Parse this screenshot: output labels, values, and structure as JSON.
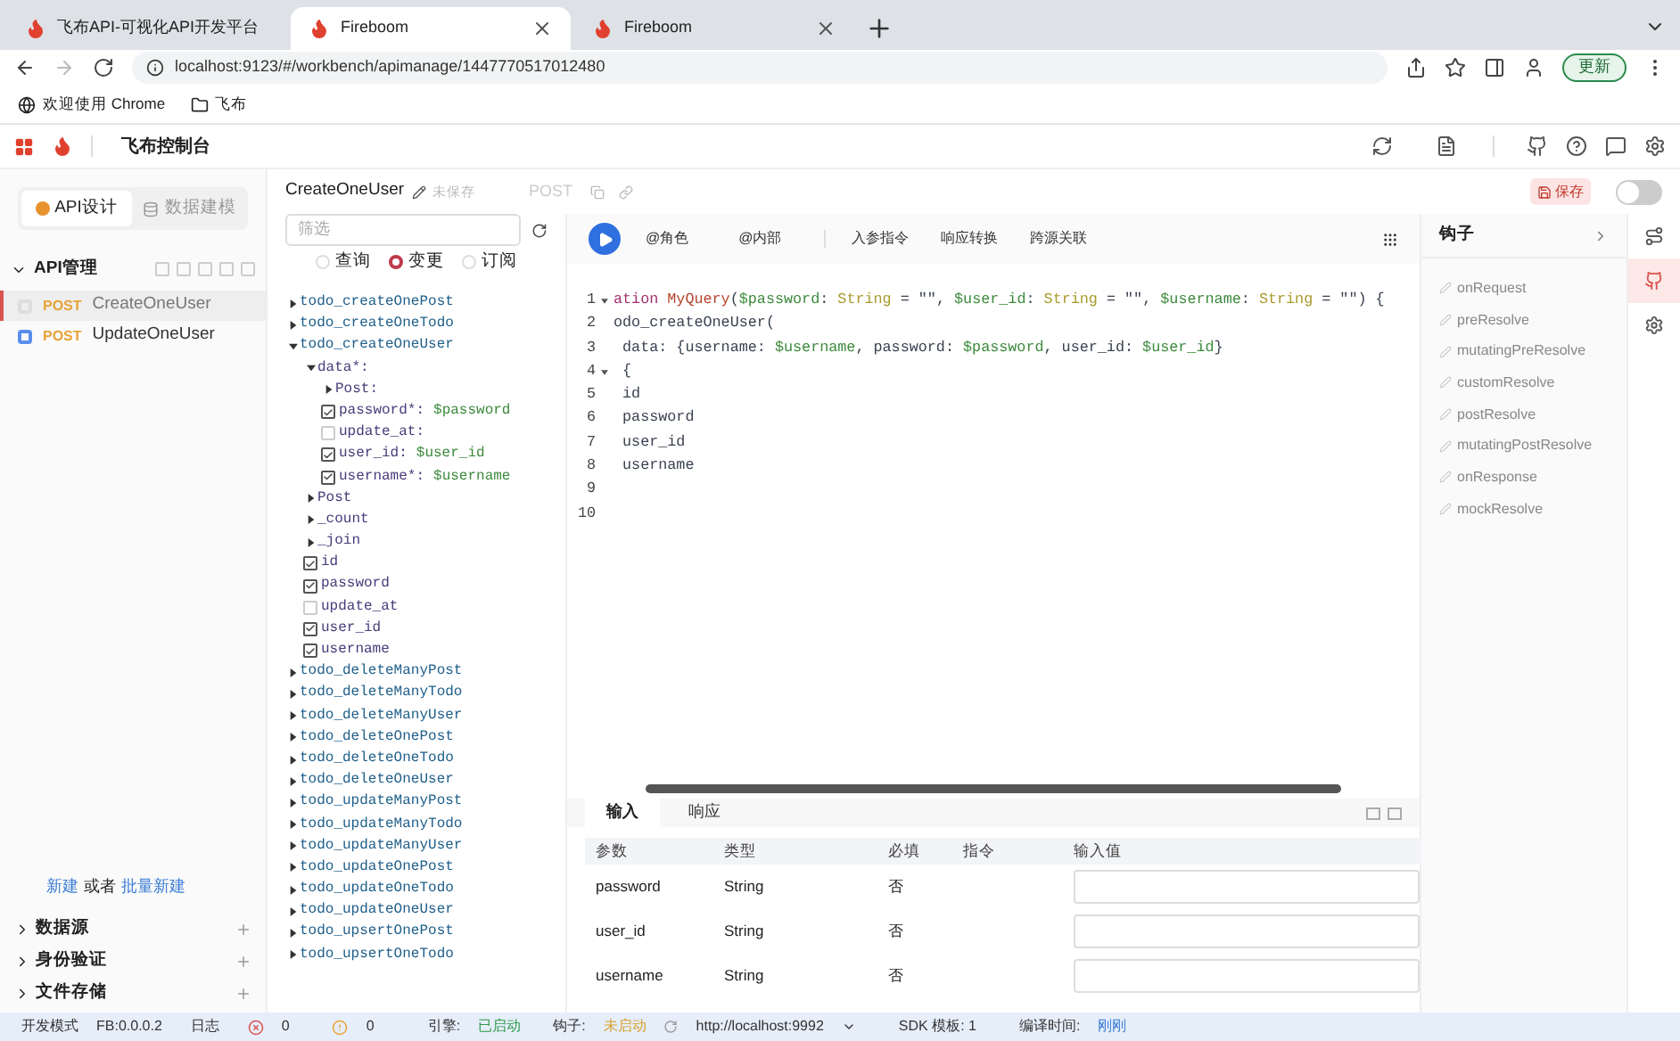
{
  "browser": {
    "tabs": [
      {
        "title": "飞布API-可视化API开发平台",
        "selected": false
      },
      {
        "title": "Fireboom",
        "selected": true
      },
      {
        "title": "Fireboom",
        "selected": false
      }
    ],
    "address": "localhost:9123/#/workbench/apimanage/1447770517012480",
    "update_button": "更新",
    "bookmarks": [
      "欢迎使用 Chrome",
      "飞布"
    ]
  },
  "app_header": {
    "title": "飞布控制台"
  },
  "sidebar": {
    "tabs": [
      {
        "label": "API设计",
        "selected": true
      },
      {
        "label": "数据建模",
        "selected": false
      }
    ],
    "section": "API管理",
    "apis": [
      {
        "method": "POST",
        "name": "CreateOneUser",
        "selected": true
      },
      {
        "method": "POST",
        "name": "UpdateOneUser",
        "selected": false
      }
    ],
    "create_link": "新建",
    "or_text": "或者",
    "batch_link": "批量新建",
    "groups": [
      "数据源",
      "身份验证",
      "文件存储"
    ]
  },
  "editor_header": {
    "name": "CreateOneUser",
    "status": "未保存",
    "method": "POST",
    "save_button": "保存",
    "toggle_on": false
  },
  "schema": {
    "filter_placeholder": "筛选",
    "radios": [
      {
        "label": "查询",
        "selected": false
      },
      {
        "label": "变更",
        "selected": true
      },
      {
        "label": "订阅",
        "selected": false
      }
    ],
    "tree": [
      {
        "kind": "branch",
        "label": "todo_createOnePost",
        "expanded": false
      },
      {
        "kind": "branch",
        "label": "todo_createOneTodo",
        "expanded": false
      },
      {
        "kind": "branch",
        "label": "todo_createOneUser",
        "expanded": true,
        "children": [
          {
            "kind": "branch",
            "label": "data*:",
            "expanded": true,
            "children": [
              {
                "kind": "branch",
                "label": "Post:",
                "expanded": false
              },
              {
                "kind": "field",
                "label": "password*:",
                "value": "$password",
                "checked": true
              },
              {
                "kind": "field",
                "label": "update_at:",
                "checked": false
              },
              {
                "kind": "field",
                "label": "user_id:",
                "value": "$user_id",
                "checked": true
              },
              {
                "kind": "field",
                "label": "username*:",
                "value": "$username",
                "checked": true
              }
            ]
          },
          {
            "kind": "branch",
            "label": "Post",
            "expanded": false
          },
          {
            "kind": "branch",
            "label": "_count",
            "expanded": false
          },
          {
            "kind": "branch",
            "label": "_join",
            "expanded": false
          },
          {
            "kind": "field",
            "label": "id",
            "checked": true
          },
          {
            "kind": "field",
            "label": "password",
            "checked": true
          },
          {
            "kind": "field",
            "label": "update_at",
            "checked": false
          },
          {
            "kind": "field",
            "label": "user_id",
            "checked": true
          },
          {
            "kind": "field",
            "label": "username",
            "checked": true
          }
        ]
      },
      {
        "kind": "branch",
        "label": "todo_deleteManyPost",
        "expanded": false
      },
      {
        "kind": "branch",
        "label": "todo_deleteManyTodo",
        "expanded": false
      },
      {
        "kind": "branch",
        "label": "todo_deleteManyUser",
        "expanded": false
      },
      {
        "kind": "branch",
        "label": "todo_deleteOnePost",
        "expanded": false
      },
      {
        "kind": "branch",
        "label": "todo_deleteOneTodo",
        "expanded": false
      },
      {
        "kind": "branch",
        "label": "todo_deleteOneUser",
        "expanded": false
      },
      {
        "kind": "branch",
        "label": "todo_updateManyPost",
        "expanded": false
      },
      {
        "kind": "branch",
        "label": "todo_updateManyTodo",
        "expanded": false
      },
      {
        "kind": "branch",
        "label": "todo_updateManyUser",
        "expanded": false
      },
      {
        "kind": "branch",
        "label": "todo_updateOnePost",
        "expanded": false
      },
      {
        "kind": "branch",
        "label": "todo_updateOneTodo",
        "expanded": false
      },
      {
        "kind": "branch",
        "label": "todo_updateOneUser",
        "expanded": false
      },
      {
        "kind": "branch",
        "label": "todo_upsertOnePost",
        "expanded": false
      },
      {
        "kind": "branch",
        "label": "todo_upsertOneTodo",
        "expanded": false
      }
    ]
  },
  "toolbar": [
    "@角色",
    "@内部",
    "入参指令",
    "响应转换",
    "跨源关联"
  ],
  "code": [
    {
      "number": "1",
      "fold": true,
      "tokens": [
        {
          "kind": "keyword",
          "text": "ation "
        },
        {
          "kind": "def",
          "text": "MyQuery"
        },
        {
          "kind": "plain",
          "text": "("
        },
        {
          "kind": "variable",
          "text": "$password"
        },
        {
          "kind": "plain",
          "text": ": "
        },
        {
          "kind": "type",
          "text": "String"
        },
        {
          "kind": "plain",
          "text": " = \"\", "
        },
        {
          "kind": "variable",
          "text": "$user_id"
        },
        {
          "kind": "plain",
          "text": ": "
        },
        {
          "kind": "type",
          "text": "String"
        },
        {
          "kind": "plain",
          "text": " = \"\", "
        },
        {
          "kind": "variable",
          "text": "$username"
        },
        {
          "kind": "plain",
          "text": ": "
        },
        {
          "kind": "type",
          "text": "String"
        },
        {
          "kind": "plain",
          "text": " = \"\") {"
        }
      ]
    },
    {
      "number": "2",
      "fold": false,
      "tokens": [
        {
          "kind": "plain",
          "text": "odo_createOneUser("
        }
      ]
    },
    {
      "number": "3",
      "fold": false,
      "tokens": [
        {
          "kind": "plain",
          "text": " data: {username: "
        },
        {
          "kind": "variable",
          "text": "$username"
        },
        {
          "kind": "plain",
          "text": ", password: "
        },
        {
          "kind": "variable",
          "text": "$password"
        },
        {
          "kind": "plain",
          "text": ", user_id: "
        },
        {
          "kind": "variable",
          "text": "$user_id"
        },
        {
          "kind": "plain",
          "text": "}"
        }
      ]
    },
    {
      "number": "4",
      "fold": true,
      "tokens": [
        {
          "kind": "plain",
          "text": " {"
        }
      ]
    },
    {
      "number": "5",
      "fold": false,
      "tokens": [
        {
          "kind": "plain",
          "text": " id"
        }
      ]
    },
    {
      "number": "6",
      "fold": false,
      "tokens": [
        {
          "kind": "plain",
          "text": " password"
        }
      ]
    },
    {
      "number": "7",
      "fold": false,
      "tokens": [
        {
          "kind": "plain",
          "text": " user_id"
        }
      ]
    },
    {
      "number": "8",
      "fold": false,
      "tokens": [
        {
          "kind": "plain",
          "text": " username"
        }
      ]
    },
    {
      "number": "9",
      "fold": false
    },
    {
      "number": "10",
      "fold": false
    }
  ],
  "io_panel": {
    "tabs": [
      {
        "label": "输入",
        "selected": true
      },
      {
        "label": "响应",
        "selected": false
      }
    ],
    "columns": [
      "参数",
      "类型",
      "必填",
      "指令",
      "输入值"
    ],
    "rows": [
      {
        "name": "password",
        "type": "String",
        "required": "否"
      },
      {
        "name": "user_id",
        "type": "String",
        "required": "否"
      },
      {
        "name": "username",
        "type": "String",
        "required": "否"
      }
    ]
  },
  "hooks": {
    "title": "钩子",
    "items": [
      "onRequest",
      "preResolve",
      "mutatingPreResolve",
      "customResolve",
      "postResolve",
      "mutatingPostResolve",
      "onResponse",
      "mockResolve"
    ]
  },
  "status_bar": {
    "mode": "开发模式",
    "version": "FB:0.0.0.2",
    "log": "日志",
    "errors": "0",
    "warnings": "0",
    "engine_label": "引擎:",
    "engine_state": "已启动",
    "hooks_label": "钩子:",
    "hooks_state": "未启动",
    "url": "http://localhost:9992",
    "sdk": "SDK 模板: 1",
    "compile_label": "编译时间:",
    "compile_value": "刚刚"
  }
}
